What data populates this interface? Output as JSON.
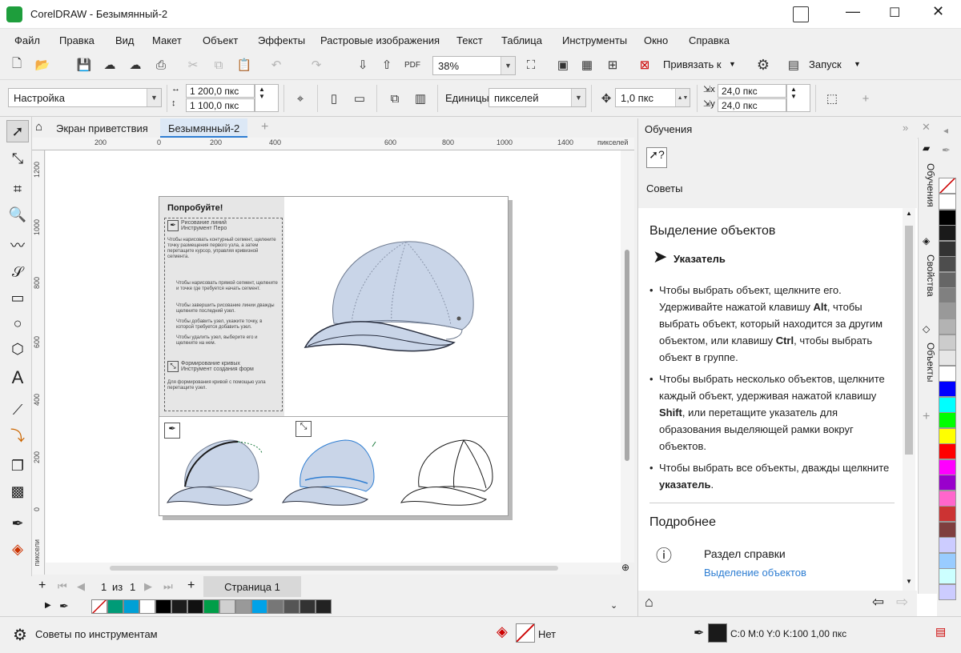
{
  "app": {
    "title": "CorelDRAW - Безымянный-2"
  },
  "menu": [
    "Файл",
    "Правка",
    "Вид",
    "Макет",
    "Объект",
    "Эффекты",
    "Растровые изображения",
    "Текст",
    "Таблица",
    "Инструменты",
    "Окно",
    "Справка"
  ],
  "toolbar1": {
    "zoom": "38%",
    "snap_label": "Привязать к",
    "launch_label": "Запуск",
    "pdf_label": "PDF"
  },
  "toolbar2": {
    "preset": "Настройка",
    "width": "1 200,0 пкс",
    "height": "1 100,0 пкс",
    "units_label": "Единицы:",
    "units": "пикселей",
    "nudge": "1,0 пкс",
    "dup_x": "24,0 пкс",
    "dup_y": "24,0 пкс"
  },
  "doc_tabs": [
    "Экран приветствия",
    "Безымянный-2"
  ],
  "ruler": {
    "h_ticks": [
      "200",
      "0",
      "200",
      "400",
      "600",
      "800",
      "1000",
      "1200",
      "1400"
    ],
    "h_unit": "пикселей",
    "v_ticks": [
      "1200",
      "1000",
      "800",
      "600",
      "400",
      "200",
      "0"
    ],
    "v_unit": "пиксели"
  },
  "page_content": {
    "try_title": "Попробуйте!",
    "pen_title": "Рисование линий\nИнструмент Перо",
    "pen_intro": "Чтобы нарисовать контурный сегмент, щелкните точку размещения первого узла, а затем перетащите курсор, управляя кривизной сегмента.",
    "pen_bullets": [
      "Чтобы нарисовать прямой сегмент, щелкните и точке где требуется начать сегмент.",
      "Чтобы завершить рисование линии дважды щелкните последний узел.",
      "Чтобы добавить узел, укажите точку, в которой требуется добавить узел.",
      "Чтобы удалить узел, выберите его и щелкните на нем."
    ],
    "shape_title": "Формирование кривых\nИнструмент создания форм",
    "shape_text": "Для формирования кривой с помощью узла перетащите узел."
  },
  "pagebar": {
    "current": "1",
    "of_label": "из",
    "total": "1",
    "page_tab": "Страница 1"
  },
  "docker": {
    "title": "Обучения",
    "tips_label": "Советы",
    "heading": "Выделение объектов",
    "tool_name": "Указатель",
    "bullets": [
      [
        "Чтобы выбрать объект, щелкните его. Удерживайте нажатой клавишу ",
        "Alt",
        ", чтобы выбрать объект, который находится за другим объектом, или клавишу ",
        "Ctrl",
        ", чтобы выбрать объект в группе."
      ],
      [
        "Чтобы выбрать несколько объектов, щелкните каждый объект, удерживая нажатой клавишу ",
        "Shift",
        ", или перетащите указатель для образования выделяющей рамки вокруг объектов."
      ],
      [
        "Чтобы выбрать все объекты, дважды щелкните ",
        "указатель",
        "."
      ]
    ],
    "more_heading": "Подробнее",
    "help_label": "Раздел справки",
    "help_link": "Выделение объектов",
    "vtabs": [
      "Обучения",
      "Свойства",
      "Объекты"
    ]
  },
  "status": {
    "hint": "Советы по инструментам",
    "fill": "Нет",
    "outline": "C:0 M:0 Y:0 K:100  1,00 пкс"
  },
  "colors": {
    "bottom_palette": [
      "#009b77",
      "#00a0d6",
      "#ffffff",
      "#000000",
      "#1c1c1c",
      "#111111",
      "#009e48",
      "#d0d0d0",
      "#999999",
      "#00a2e8",
      "#777777",
      "#555555",
      "#333333",
      "#222222"
    ],
    "right_palette": [
      "#ffffff",
      "#000000",
      "#1a1a1a",
      "#333333",
      "#4d4d4d",
      "#666666",
      "#808080",
      "#999999",
      "#b3b3b3",
      "#cccccc",
      "#e6e6e6",
      "#ffffff",
      "#0000ff",
      "#00ffff",
      "#00ff00",
      "#ffff00",
      "#ff0000",
      "#ff00ff",
      "#9900cc",
      "#ff66cc",
      "#cc3333",
      "#7f3f3f",
      "#ccccff",
      "#99ccff",
      "#ccffff",
      "#ccccff"
    ],
    "accent": "#2d7dd2"
  }
}
